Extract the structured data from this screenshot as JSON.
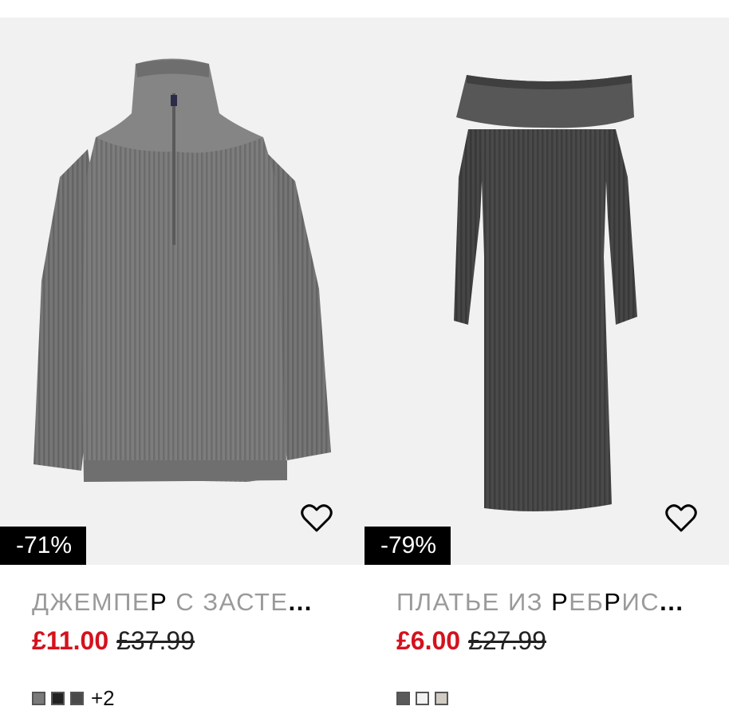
{
  "products": [
    {
      "title_prefix": "ДЖЕМПЕ",
      "title_hl": "Р",
      "title_rest": " С ЗАСТЕ",
      "title_dots": "...",
      "discount": "-71%",
      "price_sale": "£11.00",
      "price_old": "£37.99",
      "more_colors": "+2",
      "swatch_colors": [
        "#7a7a7a",
        "#222222",
        "#4a4a4a"
      ],
      "image_icon": "grey-knit-zip-jumper",
      "fav_icon": "heart-outline-icon"
    },
    {
      "title_prefix": "ПЛАТЬЕ ИЗ ",
      "title_hl": "Р",
      "title_mid": "ЕБ",
      "title_hl2": "Р",
      "title_rest": "ИС",
      "title_dots": "...",
      "discount": "-79%",
      "price_sale": "£6.00",
      "price_old": "£27.99",
      "swatch_colors": [
        "#5a5a5a",
        "#f2f2f2",
        "#d0ccc4"
      ],
      "image_icon": "dark-grey-off-shoulder-knit-dress",
      "fav_icon": "heart-outline-icon"
    }
  ]
}
